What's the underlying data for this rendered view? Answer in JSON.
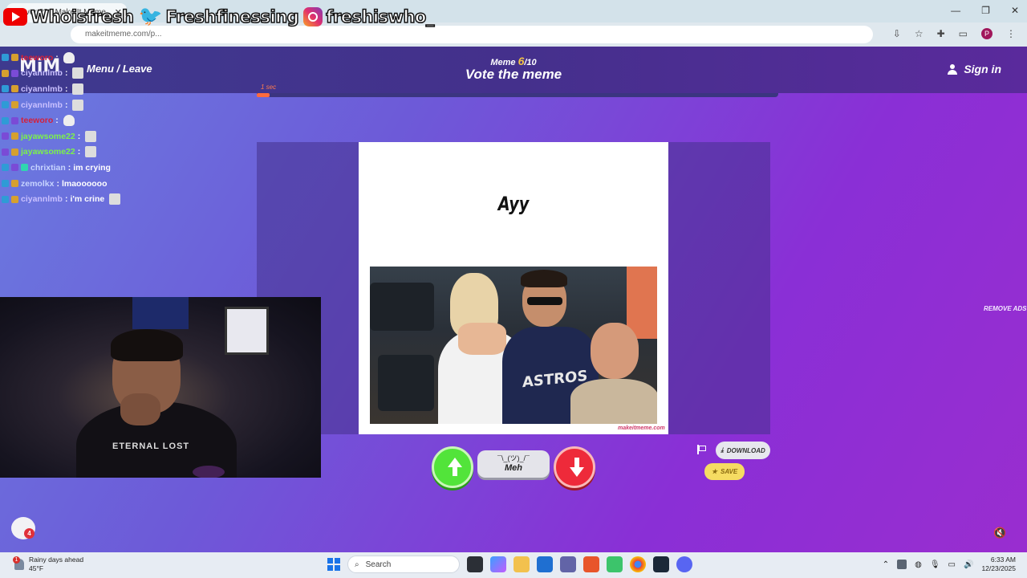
{
  "browser": {
    "tab_title": "...over ?? - Make It Meme",
    "url": "makeitmeme.com/p...",
    "window_controls": [
      "—",
      "❐",
      "✕"
    ]
  },
  "social_overlay": [
    {
      "platform_icon": "youtube-icon",
      "handle": "Whoisfresh"
    },
    {
      "platform_icon": "twitter-icon",
      "handle": "Freshfinessing"
    },
    {
      "platform_icon": "instagram-icon",
      "handle": "freshiswho_"
    }
  ],
  "game": {
    "logo": "MiM",
    "menu_leave": "Menu / Leave",
    "round_prefix": "Meme ",
    "round_current": "6",
    "round_total": "/10",
    "stage_title": "Vote the meme",
    "sign_in": "Sign in",
    "timer_label": "1 sec",
    "timer_progress": 0.025,
    "remove_ads": "REMOVE ADS",
    "accent_color": "#ff6a3d"
  },
  "meme": {
    "caption": "Ayy",
    "shirt_text": "ASTROS",
    "watermark": "makeitmeme.com"
  },
  "vote": {
    "meh_face": "¯\\_(ツ)_/¯",
    "meh_label": "Meh",
    "upvote_color": "#52e43a",
    "downvote_color": "#ee2a3a"
  },
  "actions": {
    "download": "DOWNLOAD",
    "save": "SAVE"
  },
  "chat_overlay": [
    {
      "user": "teeworo",
      "message": "",
      "emote": "skull",
      "color": "#d4203a"
    },
    {
      "user": "ciyannlmb",
      "message": "",
      "emote": "face",
      "color": "#c9c0ff"
    },
    {
      "user": "ciyannlmb",
      "message": "",
      "emote": "face",
      "color": "#c9c0ff"
    },
    {
      "user": "ciyannlmb",
      "message": "",
      "emote": "face",
      "color": "#c9c0ff"
    },
    {
      "user": "teeworo",
      "message": "",
      "emote": "skull",
      "color": "#d4203a"
    },
    {
      "user": "jayawsome22",
      "message": "",
      "emote": "face",
      "color": "#7cf24a"
    },
    {
      "user": "jayawsome22",
      "message": "",
      "emote": "face",
      "color": "#7cf24a"
    },
    {
      "user": "chrixtian",
      "message": "im crying",
      "emote": "",
      "color": "#c7d4ff"
    },
    {
      "user": "zemolkx",
      "message": "lmaoooooo",
      "emote": "",
      "color": "#c7d4ff"
    },
    {
      "user": "ciyannlmb",
      "message": "i'm crine",
      "emote": "face",
      "color": "#c9c0ff"
    }
  ],
  "webcam": {
    "hoodie_text": "ETERNAL LOST"
  },
  "chat_bubble_count": "4",
  "taskbar": {
    "weather_alert": "1",
    "weather_title": "Rainy days ahead",
    "weather_temp": "45°F",
    "search_placeholder": "Search",
    "time": "6:33 AM",
    "date": "12/23/2025"
  }
}
